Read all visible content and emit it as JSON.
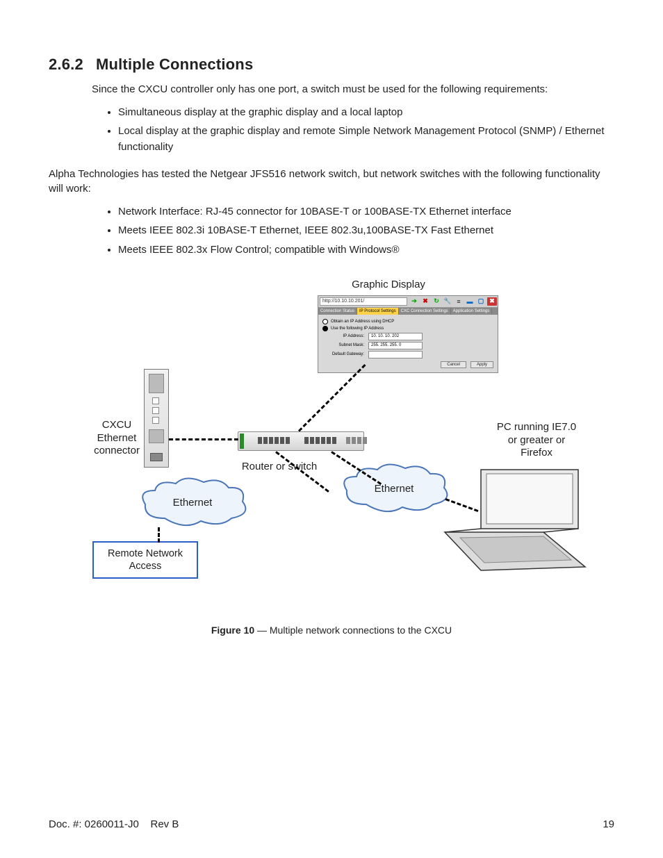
{
  "heading": {
    "number": "2.6.2",
    "title": "Multiple Connections"
  },
  "intro": "Since the CXCU controller only has one port, a switch must be used for the following requirements:",
  "req": [
    "Simultaneous display at the graphic display and a local laptop",
    "Local display at the graphic display and remote Simple Network Management Protocol (SNMP) / Ethernet functionality"
  ],
  "tested": "Alpha Technologies has tested the Netgear JFS516 network switch, but network switches with the following functionality will work:",
  "specs": [
    "Network Interface: RJ-45 connector for 10BASE-T or 100BASE-TX Ethernet interface",
    "Meets IEEE 802.3i 10BASE-T Ethernet, IEEE 802.3u,100BASE-TX Fast Ethernet",
    "Meets IEEE 802.3x Flow Control; compatible with Windows®"
  ],
  "diagram": {
    "graphic_display_title": "Graphic Display",
    "url": "http://10.10.10.201/",
    "tabs": {
      "t1": "Connection Status",
      "t2": "IP Protocol Settings",
      "t3": "CXC Connection Settings",
      "t4": "Application Settings"
    },
    "opt_dhcp": "Obtain an IP Address using DHCP",
    "opt_static": "Use the following IP Address",
    "ip_label": "IP Address:",
    "ip_value": "10. 10. 10. 202",
    "mask_label": "Subnet Mask:",
    "mask_value": "255. 255. 255. 0",
    "gw_label": "Default Gateway:",
    "btn_cancel": "Cancel",
    "btn_apply": "Apply",
    "cxcu_label": "CXCU Ethernet connector",
    "switch_label": "Router or switch",
    "pc_label": "PC running IE7.0 or greater or Firefox",
    "ethernet": "Ethernet",
    "remote": "Remote Network Access"
  },
  "figure": {
    "num": "Figure 10",
    "sep": " — ",
    "caption": "Multiple network connections to the CXCU"
  },
  "footer": {
    "doc": "Doc. #: 0260011-J0",
    "rev": "Rev B",
    "page": "19"
  }
}
